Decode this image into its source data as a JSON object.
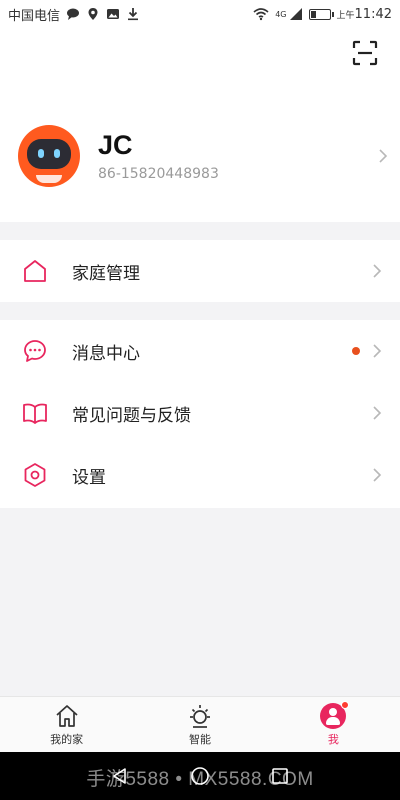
{
  "status_bar": {
    "carrier": "中国电信",
    "network": "4G",
    "time_prefix": "上午",
    "time": "11:42",
    "icons": [
      "message-bubble-icon",
      "location-icon",
      "image-icon",
      "download-icon",
      "wifi-icon",
      "signal-icon",
      "battery-icon"
    ]
  },
  "header": {
    "scan_icon": "scan-icon"
  },
  "profile": {
    "name": "JC",
    "phone": "86-15820448983"
  },
  "menu": {
    "family": {
      "label": "家庭管理",
      "icon": "home-icon"
    },
    "messages": {
      "label": "消息中心",
      "icon": "chat-bubble-icon",
      "unread": true
    },
    "faq": {
      "label": "常见问题与反馈",
      "icon": "book-icon"
    },
    "settings": {
      "label": "设置",
      "icon": "hexagon-settings-icon"
    }
  },
  "bottom_nav": {
    "items": [
      {
        "label": "我的家",
        "icon": "home-icon",
        "active": false
      },
      {
        "label": "智能",
        "icon": "sun-icon",
        "active": false
      },
      {
        "label": "我",
        "icon": "user-icon",
        "active": true
      }
    ]
  },
  "watermark": "手游5588 • MX5588.COM",
  "colors": {
    "accent": "#e8265e",
    "dot": "#e8501e",
    "avatar_bg": "#ff5a1f"
  }
}
